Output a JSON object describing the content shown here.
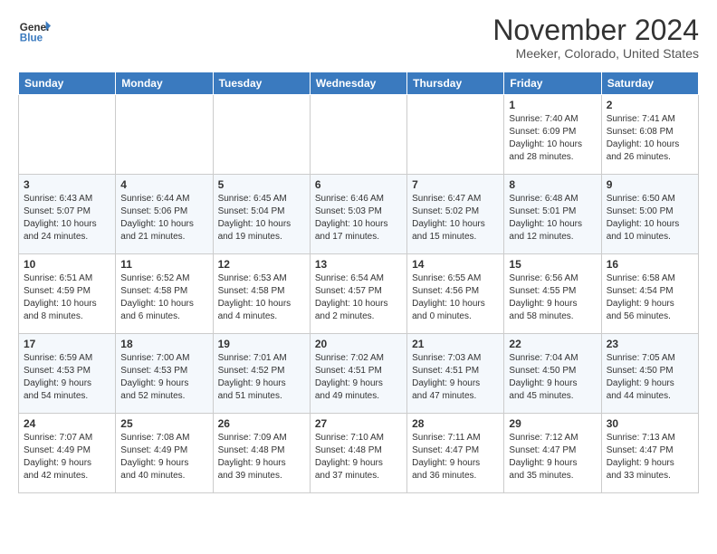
{
  "logo": {
    "general": "General",
    "blue": "Blue"
  },
  "header": {
    "month": "November 2024",
    "location": "Meeker, Colorado, United States"
  },
  "weekdays": [
    "Sunday",
    "Monday",
    "Tuesday",
    "Wednesday",
    "Thursday",
    "Friday",
    "Saturday"
  ],
  "weeks": [
    [
      {
        "day": "",
        "info": ""
      },
      {
        "day": "",
        "info": ""
      },
      {
        "day": "",
        "info": ""
      },
      {
        "day": "",
        "info": ""
      },
      {
        "day": "",
        "info": ""
      },
      {
        "day": "1",
        "info": "Sunrise: 7:40 AM\nSunset: 6:09 PM\nDaylight: 10 hours\nand 28 minutes."
      },
      {
        "day": "2",
        "info": "Sunrise: 7:41 AM\nSunset: 6:08 PM\nDaylight: 10 hours\nand 26 minutes."
      }
    ],
    [
      {
        "day": "3",
        "info": "Sunrise: 6:43 AM\nSunset: 5:07 PM\nDaylight: 10 hours\nand 24 minutes."
      },
      {
        "day": "4",
        "info": "Sunrise: 6:44 AM\nSunset: 5:06 PM\nDaylight: 10 hours\nand 21 minutes."
      },
      {
        "day": "5",
        "info": "Sunrise: 6:45 AM\nSunset: 5:04 PM\nDaylight: 10 hours\nand 19 minutes."
      },
      {
        "day": "6",
        "info": "Sunrise: 6:46 AM\nSunset: 5:03 PM\nDaylight: 10 hours\nand 17 minutes."
      },
      {
        "day": "7",
        "info": "Sunrise: 6:47 AM\nSunset: 5:02 PM\nDaylight: 10 hours\nand 15 minutes."
      },
      {
        "day": "8",
        "info": "Sunrise: 6:48 AM\nSunset: 5:01 PM\nDaylight: 10 hours\nand 12 minutes."
      },
      {
        "day": "9",
        "info": "Sunrise: 6:50 AM\nSunset: 5:00 PM\nDaylight: 10 hours\nand 10 minutes."
      }
    ],
    [
      {
        "day": "10",
        "info": "Sunrise: 6:51 AM\nSunset: 4:59 PM\nDaylight: 10 hours\nand 8 minutes."
      },
      {
        "day": "11",
        "info": "Sunrise: 6:52 AM\nSunset: 4:58 PM\nDaylight: 10 hours\nand 6 minutes."
      },
      {
        "day": "12",
        "info": "Sunrise: 6:53 AM\nSunset: 4:58 PM\nDaylight: 10 hours\nand 4 minutes."
      },
      {
        "day": "13",
        "info": "Sunrise: 6:54 AM\nSunset: 4:57 PM\nDaylight: 10 hours\nand 2 minutes."
      },
      {
        "day": "14",
        "info": "Sunrise: 6:55 AM\nSunset: 4:56 PM\nDaylight: 10 hours\nand 0 minutes."
      },
      {
        "day": "15",
        "info": "Sunrise: 6:56 AM\nSunset: 4:55 PM\nDaylight: 9 hours\nand 58 minutes."
      },
      {
        "day": "16",
        "info": "Sunrise: 6:58 AM\nSunset: 4:54 PM\nDaylight: 9 hours\nand 56 minutes."
      }
    ],
    [
      {
        "day": "17",
        "info": "Sunrise: 6:59 AM\nSunset: 4:53 PM\nDaylight: 9 hours\nand 54 minutes."
      },
      {
        "day": "18",
        "info": "Sunrise: 7:00 AM\nSunset: 4:53 PM\nDaylight: 9 hours\nand 52 minutes."
      },
      {
        "day": "19",
        "info": "Sunrise: 7:01 AM\nSunset: 4:52 PM\nDaylight: 9 hours\nand 51 minutes."
      },
      {
        "day": "20",
        "info": "Sunrise: 7:02 AM\nSunset: 4:51 PM\nDaylight: 9 hours\nand 49 minutes."
      },
      {
        "day": "21",
        "info": "Sunrise: 7:03 AM\nSunset: 4:51 PM\nDaylight: 9 hours\nand 47 minutes."
      },
      {
        "day": "22",
        "info": "Sunrise: 7:04 AM\nSunset: 4:50 PM\nDaylight: 9 hours\nand 45 minutes."
      },
      {
        "day": "23",
        "info": "Sunrise: 7:05 AM\nSunset: 4:50 PM\nDaylight: 9 hours\nand 44 minutes."
      }
    ],
    [
      {
        "day": "24",
        "info": "Sunrise: 7:07 AM\nSunset: 4:49 PM\nDaylight: 9 hours\nand 42 minutes."
      },
      {
        "day": "25",
        "info": "Sunrise: 7:08 AM\nSunset: 4:49 PM\nDaylight: 9 hours\nand 40 minutes."
      },
      {
        "day": "26",
        "info": "Sunrise: 7:09 AM\nSunset: 4:48 PM\nDaylight: 9 hours\nand 39 minutes."
      },
      {
        "day": "27",
        "info": "Sunrise: 7:10 AM\nSunset: 4:48 PM\nDaylight: 9 hours\nand 37 minutes."
      },
      {
        "day": "28",
        "info": "Sunrise: 7:11 AM\nSunset: 4:47 PM\nDaylight: 9 hours\nand 36 minutes."
      },
      {
        "day": "29",
        "info": "Sunrise: 7:12 AM\nSunset: 4:47 PM\nDaylight: 9 hours\nand 35 minutes."
      },
      {
        "day": "30",
        "info": "Sunrise: 7:13 AM\nSunset: 4:47 PM\nDaylight: 9 hours\nand 33 minutes."
      }
    ]
  ]
}
